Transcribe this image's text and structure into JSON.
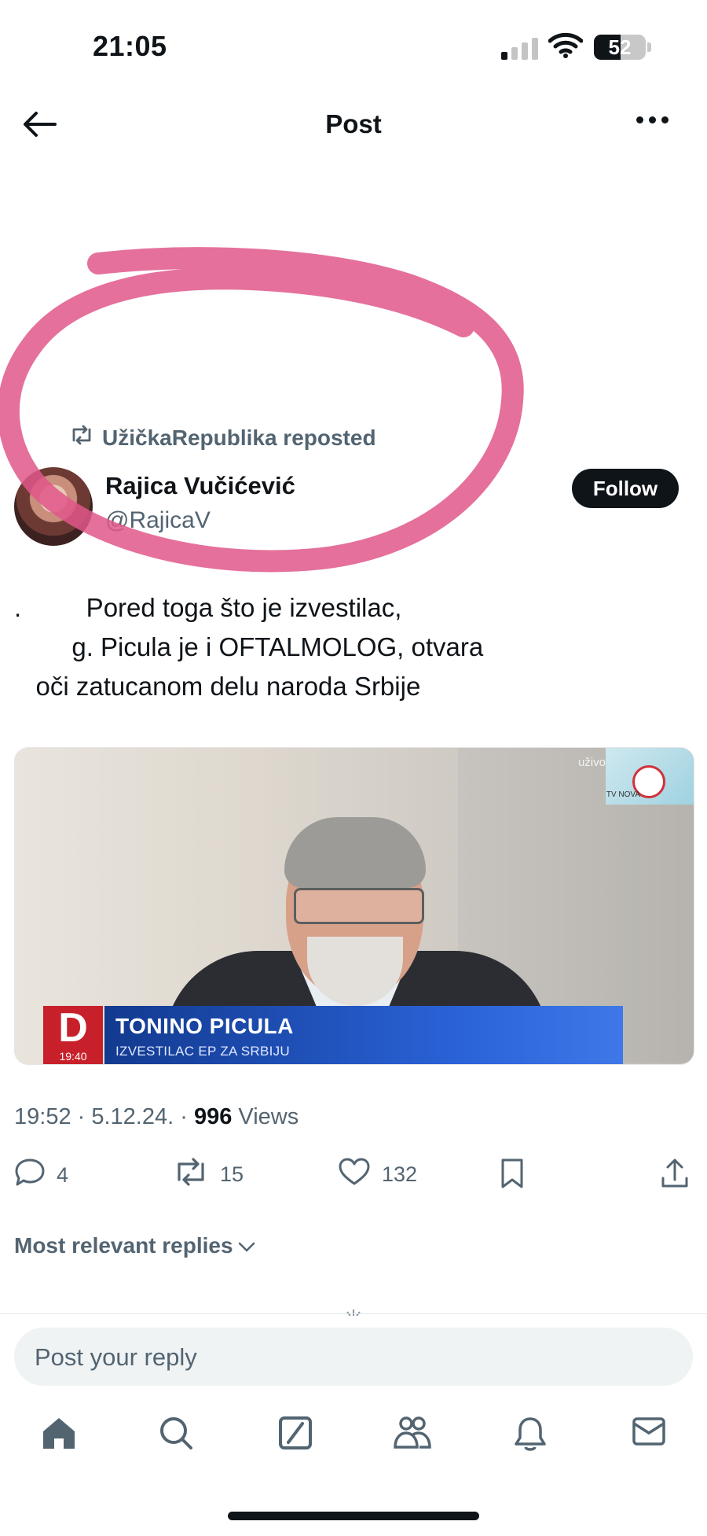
{
  "status_bar": {
    "time": "21:05",
    "battery": "52"
  },
  "header": {
    "title": "Post"
  },
  "repost": {
    "label": "UžičkaRepublika reposted"
  },
  "author": {
    "name": "Rajica Vučićević",
    "handle": "@RajicaV"
  },
  "follow_label": "Follow",
  "post": {
    "text": ".         Pored toga što je izvestilac,\n        g. Picula je i OFTALMOLOG, otvara\n   oči zatucanom delu naroda Srbije"
  },
  "media": {
    "name": "TONINO PICULA",
    "role": "IZVESTILAC EP ZA SRBIJU",
    "channel_letter": "D",
    "channel_time": "19:40",
    "live_label": "uživo",
    "channel_brand": "TV NOVA"
  },
  "meta": {
    "time": "19:52",
    "date": "5.12.24.",
    "views_count": "996",
    "views_label": "Views"
  },
  "actions": {
    "replies": "4",
    "reposts": "15",
    "likes": "132"
  },
  "replies_filter": "Most relevant replies",
  "reply_box": {
    "placeholder": "Post your reply"
  },
  "colors": {
    "text": "#0f1419",
    "secondary": "#536471",
    "annotation": "#e0578a",
    "lower_third": "#2b63d9",
    "channel_red": "#c8202a"
  },
  "icons": [
    "back-arrow-icon",
    "more-icon",
    "repost-icon",
    "reply-icon",
    "like-icon",
    "bookmark-icon",
    "share-icon",
    "home-icon",
    "search-icon",
    "grok-icon",
    "communities-icon",
    "notifications-icon",
    "messages-icon"
  ]
}
